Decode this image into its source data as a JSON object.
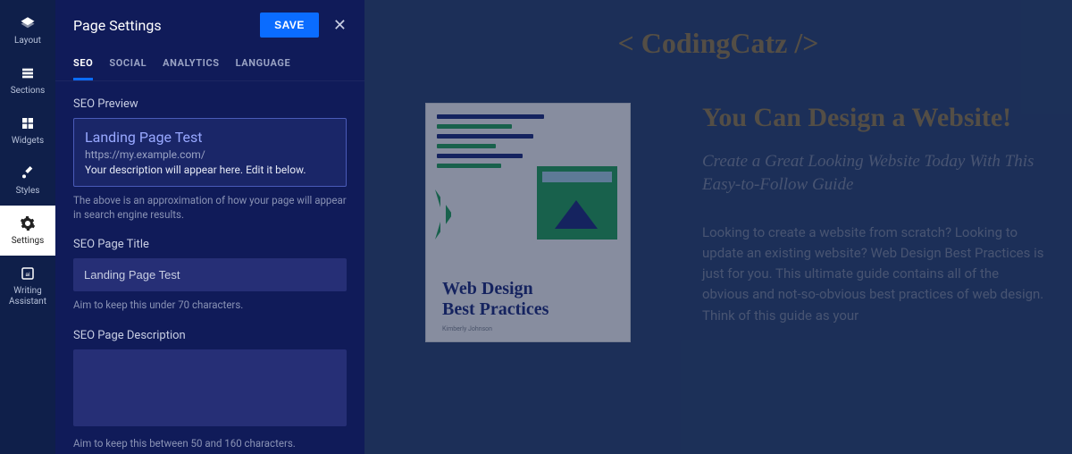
{
  "rail": {
    "items": [
      {
        "label": "Layout"
      },
      {
        "label": "Sections"
      },
      {
        "label": "Widgets"
      },
      {
        "label": "Styles"
      },
      {
        "label": "Settings"
      },
      {
        "label": "Writing Assistant"
      }
    ]
  },
  "panel": {
    "title": "Page Settings",
    "save": "SAVE",
    "tabs": [
      "SEO",
      "SOCIAL",
      "ANALYTICS",
      "LANGUAGE"
    ],
    "seo_preview_label": "SEO Preview",
    "preview": {
      "title": "Landing Page Test",
      "url": "https://my.example.com/",
      "desc": "Your description will appear here. Edit it below."
    },
    "preview_hint": "The above is an approximation of how your page will appear in search engine results.",
    "title_label": "SEO Page Title",
    "title_value": "Landing Page Test",
    "title_hint": "Aim to keep this under 70 characters.",
    "desc_label": "SEO Page Description",
    "desc_value": "",
    "desc_hint": "Aim to keep this between 50 and 160 characters."
  },
  "canvas": {
    "brand": "< CodingCatz />",
    "headline": "You Can Design a Website!",
    "subhead": "Create a Great Looking Website Today With This Easy-to-Follow Guide",
    "para": "Looking to create a website from scratch? Looking to update an existing website? Web Design Best Practices is just for you. This ultimate guide contains all of the obvious and not-so-obvious best practices of web design. Think of this guide as your",
    "book_title": "Web Design\nBest Practices",
    "book_author": "Kimberly Johnson"
  }
}
